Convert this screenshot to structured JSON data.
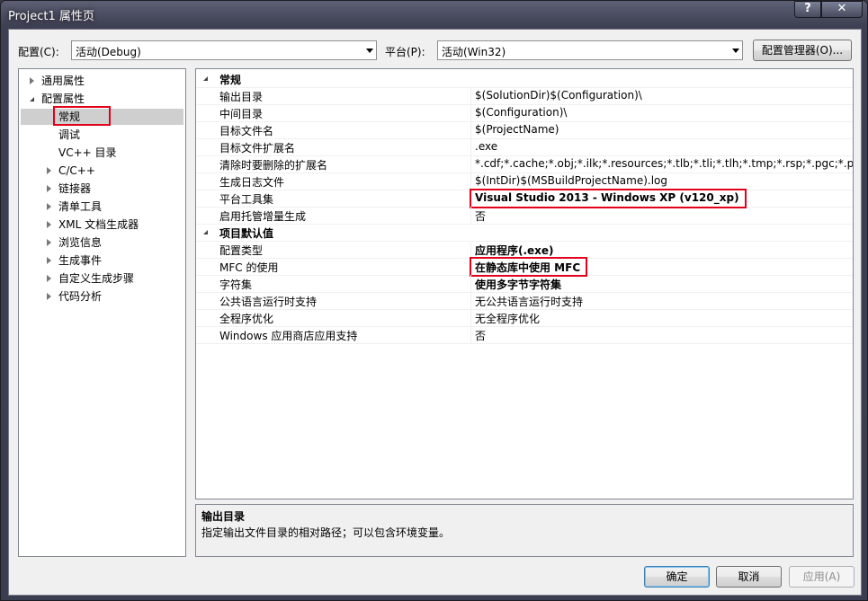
{
  "window": {
    "title": "Project1 属性页",
    "help": "?",
    "close": "✕"
  },
  "toolbar": {
    "config_label": "配置(C):",
    "config_value": "活动(Debug)",
    "platform_label": "平台(P):",
    "platform_value": "活动(Win32)",
    "config_manager": "配置管理器(O)..."
  },
  "tree": [
    {
      "label": "通用属性",
      "level": 0,
      "state": "collapsed"
    },
    {
      "label": "配置属性",
      "level": 0,
      "state": "expanded"
    },
    {
      "label": "常规",
      "level": 1,
      "state": "none",
      "selected": true,
      "highlight": true
    },
    {
      "label": "调试",
      "level": 1,
      "state": "none"
    },
    {
      "label": "VC++ 目录",
      "level": 1,
      "state": "none"
    },
    {
      "label": "C/C++",
      "level": 1,
      "state": "collapsed"
    },
    {
      "label": "链接器",
      "level": 1,
      "state": "collapsed"
    },
    {
      "label": "清单工具",
      "level": 1,
      "state": "collapsed"
    },
    {
      "label": "XML 文档生成器",
      "level": 1,
      "state": "collapsed"
    },
    {
      "label": "浏览信息",
      "level": 1,
      "state": "collapsed"
    },
    {
      "label": "生成事件",
      "level": 1,
      "state": "collapsed"
    },
    {
      "label": "自定义生成步骤",
      "level": 1,
      "state": "collapsed"
    },
    {
      "label": "代码分析",
      "level": 1,
      "state": "collapsed"
    }
  ],
  "grid": [
    {
      "type": "header",
      "name": "常规"
    },
    {
      "type": "row",
      "name": "输出目录",
      "value": "$(SolutionDir)$(Configuration)\\"
    },
    {
      "type": "row",
      "name": "中间目录",
      "value": "$(Configuration)\\"
    },
    {
      "type": "row",
      "name": "目标文件名",
      "value": "$(ProjectName)"
    },
    {
      "type": "row",
      "name": "目标文件扩展名",
      "value": ".exe"
    },
    {
      "type": "row",
      "name": "清除时要删除的扩展名",
      "value": "*.cdf;*.cache;*.obj;*.ilk;*.resources;*.tlb;*.tli;*.tlh;*.tmp;*.rsp;*.pgc;*.pgd;*.me"
    },
    {
      "type": "row",
      "name": "生成日志文件",
      "value": "$(IntDir)$(MSBuildProjectName).log"
    },
    {
      "type": "row",
      "name": "平台工具集",
      "value": "Visual Studio 2013 - Windows XP (v120_xp)",
      "bold": true,
      "highlight": true
    },
    {
      "type": "row",
      "name": "启用托管增量生成",
      "value": "否"
    },
    {
      "type": "header",
      "name": "项目默认值"
    },
    {
      "type": "row",
      "name": "配置类型",
      "value": "应用程序(.exe)",
      "bold": true
    },
    {
      "type": "row",
      "name": "MFC 的使用",
      "value": "在静态库中使用 MFC",
      "bold": true,
      "highlight": true
    },
    {
      "type": "row",
      "name": "字符集",
      "value": "使用多字节字符集",
      "bold": true
    },
    {
      "type": "row",
      "name": "公共语言运行时支持",
      "value": "无公共语言运行时支持"
    },
    {
      "type": "row",
      "name": "全程序优化",
      "value": "无全程序优化"
    },
    {
      "type": "row",
      "name": "Windows 应用商店应用支持",
      "value": "否"
    }
  ],
  "description": {
    "title": "输出目录",
    "text": "指定输出文件目录的相对路径；可以包含环境变量。"
  },
  "buttons": {
    "ok": "确定",
    "cancel": "取消",
    "apply": "应用(A)"
  },
  "colors": {
    "highlight_box": "#e3001b",
    "selected_node": "#cfcfcf"
  }
}
